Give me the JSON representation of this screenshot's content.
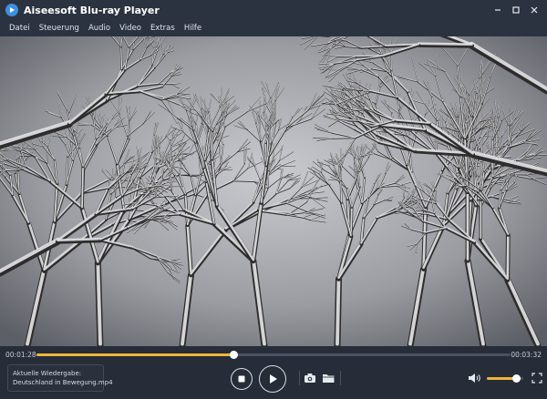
{
  "window": {
    "title": "Aiseesoft Blu-ray Player",
    "controls": [
      "minimize-icon",
      "maximize-icon",
      "close-icon"
    ]
  },
  "menu": [
    {
      "label": "Datei"
    },
    {
      "label": "Steuerung"
    },
    {
      "label": "Audio"
    },
    {
      "label": "Video"
    },
    {
      "label": "Extras"
    },
    {
      "label": "Hilfe"
    }
  ],
  "video": {
    "scene": "snow-covered-trees"
  },
  "playback": {
    "current_time": "00:01:28",
    "total_time": "00:03:32",
    "progress_fraction": 0.415,
    "volume_fraction": 0.8
  },
  "now_playing": {
    "label": "Aktuelle Wiedergabe:",
    "file": "Deutschland in Bewegung.mp4"
  },
  "icons": {
    "stop": "stop-icon",
    "play": "play-icon",
    "snapshot": "camera-icon",
    "open": "folder-icon",
    "volume": "speaker-icon",
    "fullscreen": "fullscreen-icon"
  },
  "colors": {
    "accent": "#f0b43a",
    "background": "#2b3340",
    "controls_bg": "#262d38"
  }
}
